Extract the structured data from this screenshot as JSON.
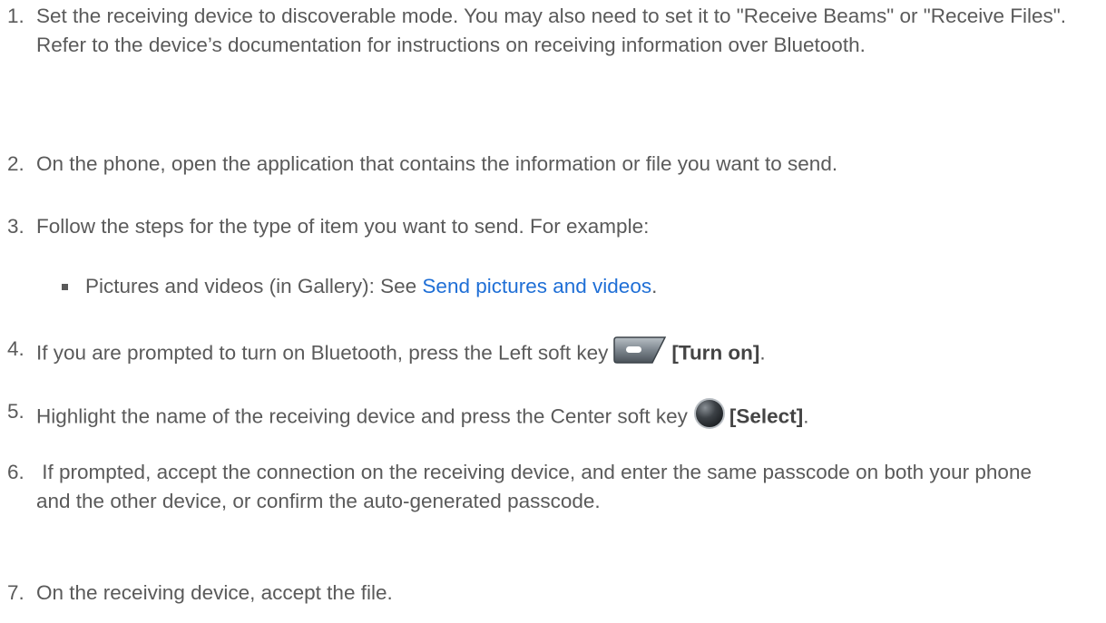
{
  "steps": [
    {
      "num": "1.",
      "text": "Set the receiving device to discoverable mode. You may also need to set it to \"Receive Beams\" or \"Receive Files\". Refer to the device’s documentation for instructions on receiving information over Bluetooth."
    },
    {
      "num": "2.",
      "text": "On the phone, open the application that contains the information or file you want to send."
    },
    {
      "num": "3.",
      "text": "Follow the steps for the type of item you want to send. For example:"
    },
    {
      "num": "4.",
      "text_before": "If you are prompted to turn on Bluetooth, press the Left soft key",
      "icon": "left-soft-key-icon",
      "bold": "[Turn on]",
      "after": "."
    },
    {
      "num": "5.",
      "text_before": "Highlight the name of the receiving device and press the Center soft key",
      "icon": "center-soft-key-icon",
      "bold": "[Select]",
      "after": "."
    },
    {
      "num": "6.",
      "text": " If prompted, accept the connection on the receiving device, and enter the same passcode on both your phone and the other device, or confirm the auto-generated passcode."
    },
    {
      "num": "7.",
      "text": "On the receiving device, accept the file."
    }
  ],
  "sub_item": {
    "text_before": "Pictures and videos (in Gallery): See ",
    "link": "Send pictures and videos",
    "after": "."
  },
  "colors": {
    "text": "#5a5a5a",
    "link": "#1f6fd6"
  }
}
